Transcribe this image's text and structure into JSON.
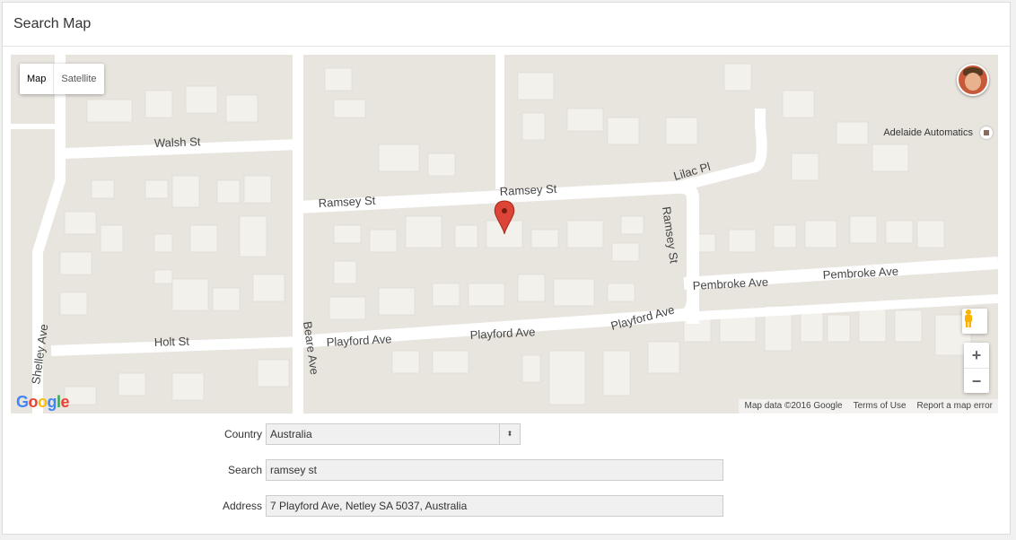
{
  "panel": {
    "title": "Search Map"
  },
  "map": {
    "type_controls": {
      "map_label": "Map",
      "satellite_label": "Satellite"
    },
    "poi_label": "Adelaide Automatics",
    "attribution": {
      "data": "Map data ©2016 Google",
      "terms": "Terms of Use",
      "report": "Report a map error"
    },
    "google_logo": "Google",
    "zoom_in": "+",
    "zoom_out": "−",
    "street_labels": [
      "Walsh St",
      "Ramsey St",
      "Ramsey St",
      "Lilac Pl",
      "Ramsey St",
      "Pembroke Ave",
      "Pembroke Ave",
      "Holt St",
      "Playford Ave",
      "Playford Ave",
      "Playford Ave",
      "Beare Ave",
      "Shelley Ave"
    ],
    "marker": "red-location-pin"
  },
  "form": {
    "country_label": "Country",
    "country_value": "Australia",
    "search_label": "Search",
    "search_value": "ramsey st",
    "address_label": "Address",
    "address_value": "7 Playford Ave, Netley SA 5037, Australia"
  },
  "colors": {
    "map_bg": "#e8e4de",
    "road": "#ffffff",
    "building": "#f3f1ec",
    "marker": "#db4437"
  }
}
